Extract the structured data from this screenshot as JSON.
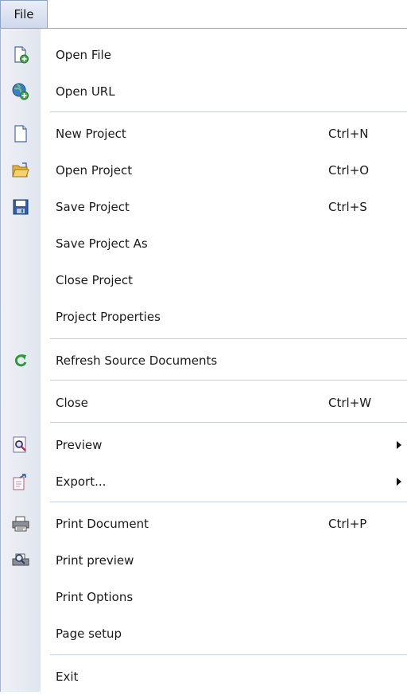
{
  "menubar": {
    "file_label": "File"
  },
  "menu": {
    "items": [
      {
        "label": "Open File",
        "shortcut": "",
        "icon": "open-file-icon"
      },
      {
        "label": "Open URL",
        "shortcut": "",
        "icon": "open-url-icon"
      },
      {
        "label": "New Project",
        "shortcut": "Ctrl+N",
        "icon": "new-project-icon"
      },
      {
        "label": "Open Project",
        "shortcut": "Ctrl+O",
        "icon": "open-project-folder-icon"
      },
      {
        "label": "Save Project",
        "shortcut": "Ctrl+S",
        "icon": "save-disk-icon"
      },
      {
        "label": "Save Project As",
        "shortcut": ""
      },
      {
        "label": "Close Project",
        "shortcut": ""
      },
      {
        "label": "Project Properties",
        "shortcut": ""
      },
      {
        "label": "Refresh Source Documents",
        "shortcut": "",
        "icon": "refresh-icon"
      },
      {
        "label": "Close",
        "shortcut": "Ctrl+W"
      },
      {
        "label": "Preview",
        "shortcut": "",
        "icon": "preview-magnifier-icon",
        "submenu": true
      },
      {
        "label": "Export...",
        "shortcut": "",
        "icon": "export-icon",
        "submenu": true
      },
      {
        "label": "Print Document",
        "shortcut": "Ctrl+P",
        "icon": "printer-icon"
      },
      {
        "label": "Print preview",
        "shortcut": "",
        "icon": "print-preview-icon"
      },
      {
        "label": "Print Options",
        "shortcut": ""
      },
      {
        "label": "Page setup",
        "shortcut": ""
      },
      {
        "label": "Exit",
        "shortcut": ""
      }
    ]
  }
}
